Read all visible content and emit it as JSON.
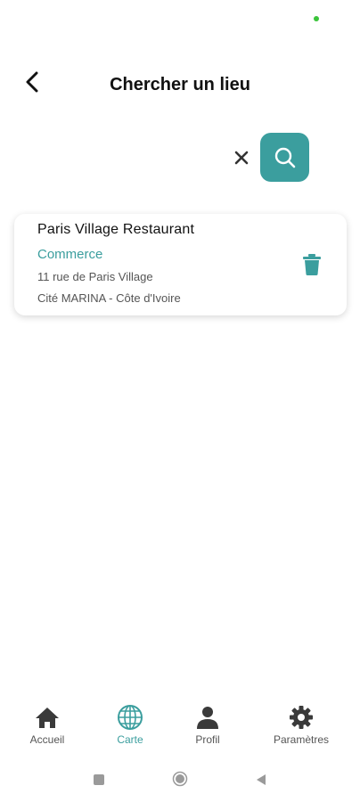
{
  "header": {
    "title": "Chercher un lieu",
    "back_icon": "chevron-left-icon"
  },
  "search": {
    "clear_icon": "close-icon",
    "search_icon": "search-icon",
    "accent_color": "#3b9e9e"
  },
  "results": [
    {
      "name": "Paris Village Restaurant",
      "category": "Commerce",
      "address": "11 rue de Paris Village",
      "city": "Cité MARINA - Côte d'Ivoire",
      "delete_icon": "trash-icon"
    }
  ],
  "bottom_nav": {
    "items": [
      {
        "label": "Accueil",
        "icon": "home-icon",
        "active": false
      },
      {
        "label": "Carte",
        "icon": "globe-icon",
        "active": true
      },
      {
        "label": "Profil",
        "icon": "person-icon",
        "active": false
      },
      {
        "label": "Paramètres",
        "icon": "gear-icon",
        "active": false
      }
    ]
  },
  "system_nav": {
    "icons": [
      "recent-apps-icon",
      "home-circle-icon",
      "back-triangle-icon"
    ]
  }
}
